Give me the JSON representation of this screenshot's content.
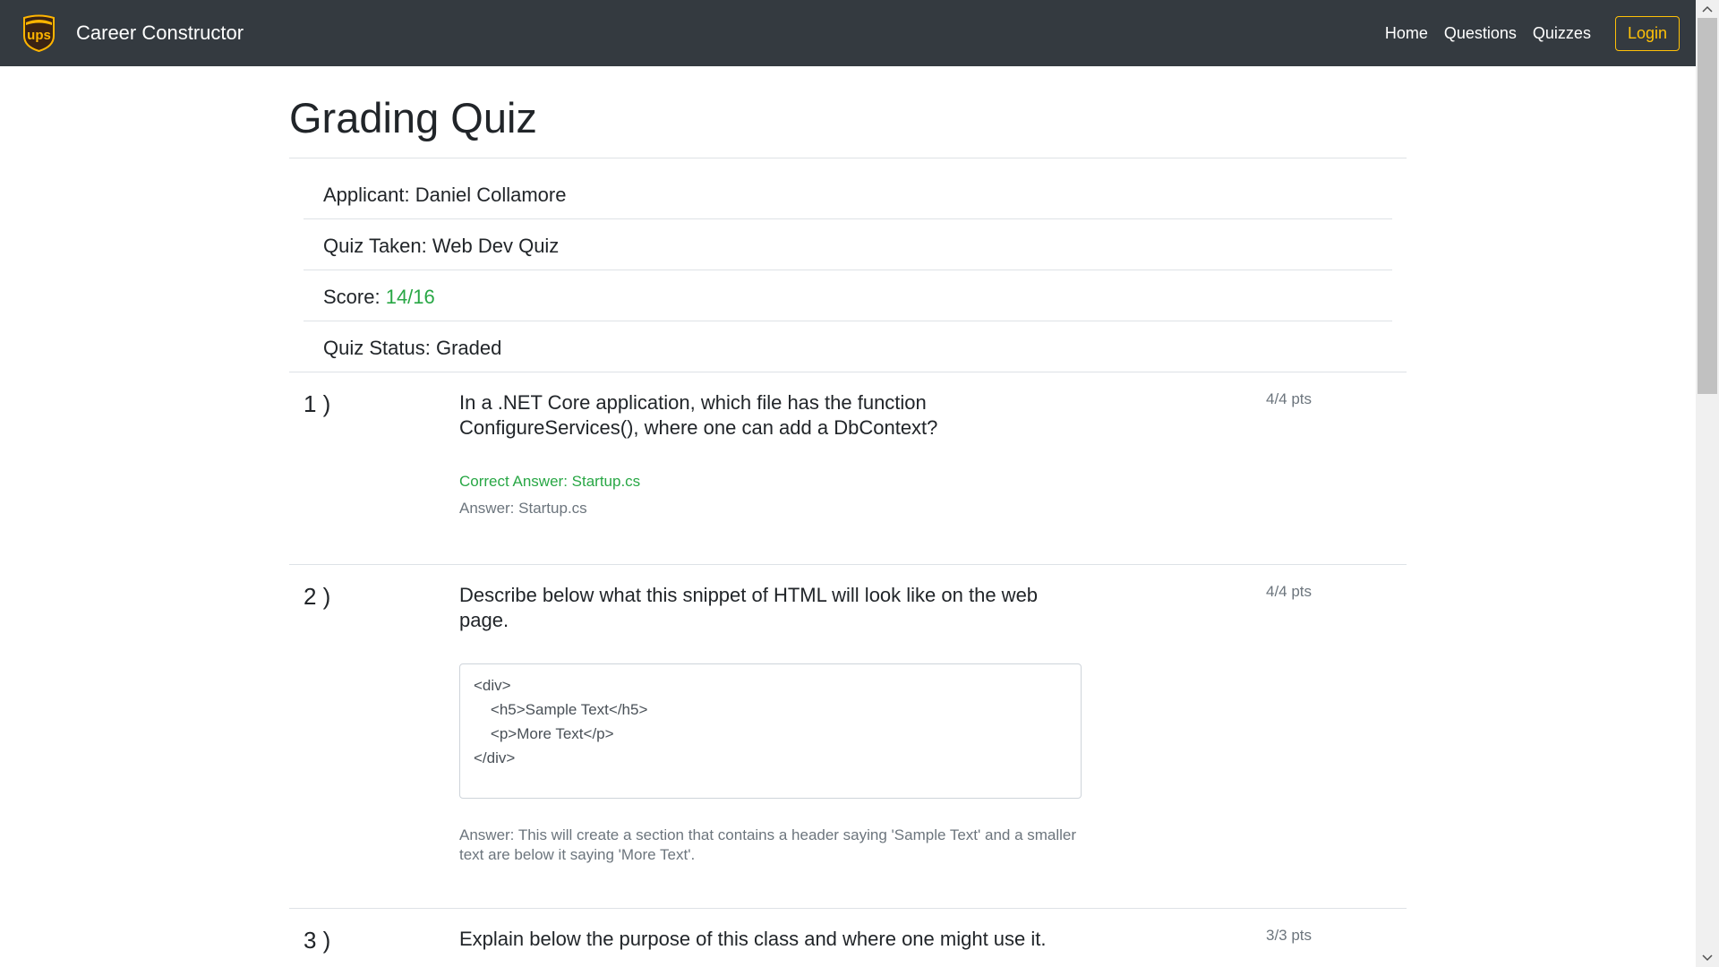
{
  "navbar": {
    "brand": "Career Constructor",
    "logo_text": "ups",
    "links": [
      "Home",
      "Questions",
      "Quizzes"
    ],
    "login": "Login"
  },
  "page": {
    "title": "Grading Quiz"
  },
  "summary": {
    "applicant_label": "Applicant: ",
    "applicant": "Daniel Collamore",
    "quiz_label": "Quiz Taken: ",
    "quiz": "Web Dev Quiz",
    "score_label": "Score: ",
    "score": "14/16",
    "status_label": "Quiz Status: ",
    "status": "Graded"
  },
  "questions": [
    {
      "number": "1 )",
      "points": "4/4 pts",
      "text": "In a .NET Core application, which file has the function ConfigureServices(), where one can add a DbContext?",
      "correct_answer": "Correct Answer: Startup.cs",
      "answer": "Answer: Startup.cs"
    },
    {
      "number": "2 )",
      "points": "4/4 pts",
      "text": "Describe below what this snippet of HTML will look like on the web page.",
      "code": "<div>\n    <h5>Sample Text</h5>\n    <p>More Text</p>\n</div>",
      "answer": "Answer: This will create a section that contains a header saying 'Sample Text' and a smaller text are below it saying 'More Text'."
    },
    {
      "number": "3 )",
      "points": "3/3 pts",
      "text": "Explain below the purpose of this class and where one might use it."
    }
  ],
  "colors": {
    "navbar_bg": "#343a40",
    "accent_warning": "#ffc107",
    "success": "#28a745",
    "muted": "#6c757d"
  }
}
